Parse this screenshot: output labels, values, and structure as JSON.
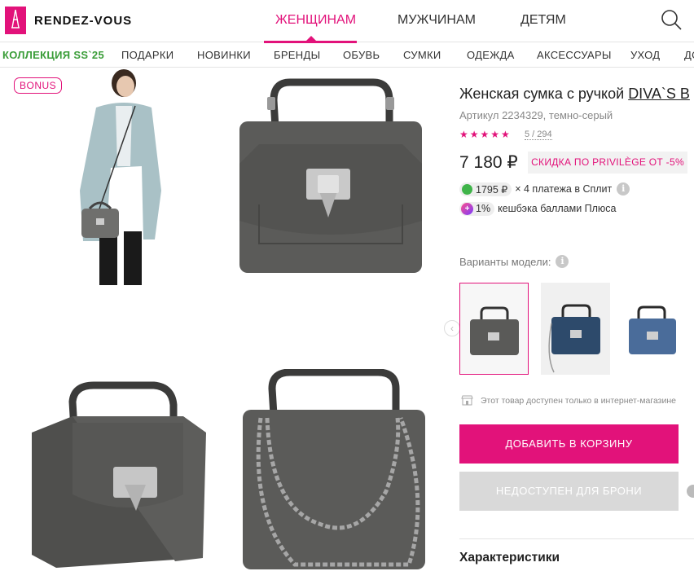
{
  "header": {
    "logo_text": "RENDEZ-VOUS",
    "gender_nav": [
      "ЖЕНЩИНАМ",
      "МУЖЧИНАМ",
      "ДЕТЯМ"
    ],
    "active_gender": "ЖЕНЩИНАМ"
  },
  "categories": [
    "КОЛЛЕКЦИЯ SS`25",
    "ПОДАРКИ",
    "НОВИНКИ",
    "БРЕНДЫ",
    "ОБУВЬ",
    "СУМКИ",
    "ОДЕЖДА",
    "АКСЕССУАРЫ",
    "УХОД",
    "ДО"
  ],
  "gallery": {
    "bonus_badge": "BONUS"
  },
  "product": {
    "title_prefix": "Женская сумка с ручкой",
    "brand": "DIVA`S B",
    "sku": "Артикул 2234329, темно-серый",
    "stars": "★★★★★",
    "rating": "5 / 294",
    "price": "7 180 ₽",
    "promo": "СКИДКА ПО PRIVILÈGE ОТ -5%",
    "split_amount": "1795 ₽",
    "split_text": "× 4 платежа в Сплит",
    "cashback_pct": "1%",
    "cashback_text": "кешбэка баллами Плюса",
    "variants_label": "Варианты модели:",
    "online_note": "Этот товар доступен только в интернет-магазине",
    "add_to_cart": "ДОБАВИТЬ В КОРЗИНУ",
    "reserve": "НЕДОСТУПЕН ДЛЯ БРОНИ",
    "specs_title": "Характеристики"
  },
  "colors": {
    "accent": "#e2127a",
    "promo_green": "#3a9d38",
    "bag_grey": "#5a5a58",
    "bag_navy": "#2d4a6b",
    "bag_blue": "#4a6c9a"
  }
}
